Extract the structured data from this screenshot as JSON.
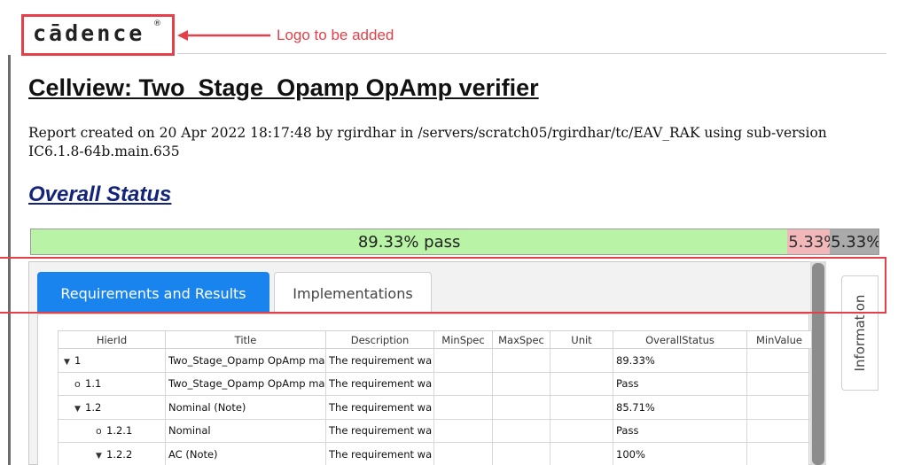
{
  "logo": {
    "text": "cādence",
    "registered_mark": "®"
  },
  "annotations": {
    "logo_note": "Logo to be added"
  },
  "report": {
    "title": "Cellview: Two_Stage_Opamp OpAmp verifier",
    "meta": "Report created on 20 Apr 2022 18:17:48 by rgirdhar in /servers/scratch05/rgirdhar/tc/EAV_RAK using sub-version IC6.1.8-64b.main.635",
    "overall_status_heading": "Overall Status"
  },
  "status_bar": {
    "pass_fraction": 0.8933,
    "pass_label": "89.33% pass",
    "fail_label": "5.33%",
    "other_label": "5.33%",
    "colors": {
      "pass": "#b8f3a6",
      "fail": "#f2b7b8",
      "other": "#aaaaaa"
    }
  },
  "tabs": [
    {
      "label": "Requirements and Results",
      "active": true
    },
    {
      "label": "Implementations",
      "active": false
    }
  ],
  "side_tab": {
    "label": "Information"
  },
  "table": {
    "columns": [
      "HierId",
      "Title",
      "Description",
      "MinSpec",
      "MaxSpec",
      "Unit",
      "OverallStatus",
      "MinValue"
    ],
    "rows": [
      {
        "hierid": "1",
        "node": "expanded",
        "title": "Two_Stage_Opamp OpAmp ma",
        "description": "The requirement wa",
        "overall_status": "89.33%",
        "status_type": "fail"
      },
      {
        "hierid": "1.1",
        "node": "leaf",
        "title": "Two_Stage_Opamp OpAmp ma",
        "description": "The requirement wa",
        "overall_status": "Pass",
        "status_type": "pass"
      },
      {
        "hierid": "1.2",
        "node": "expanded",
        "title": "Nominal (Note)",
        "description": "The requirement wa",
        "overall_status": "85.71%",
        "status_type": "fail"
      },
      {
        "hierid": "1.2.1",
        "node": "leaf",
        "title": "Nominal",
        "description": "The requirement wa",
        "overall_status": "Pass",
        "status_type": "pass"
      },
      {
        "hierid": "1.2.2",
        "node": "expanded",
        "title": "AC (Note)",
        "description": "The requirement wa",
        "overall_status": "100%",
        "status_type": "pass"
      }
    ]
  },
  "accent_colors": {
    "annotation_red": "#e5404a",
    "active_tab_blue": "#1a84ee",
    "heading_navy": "#14247a"
  }
}
